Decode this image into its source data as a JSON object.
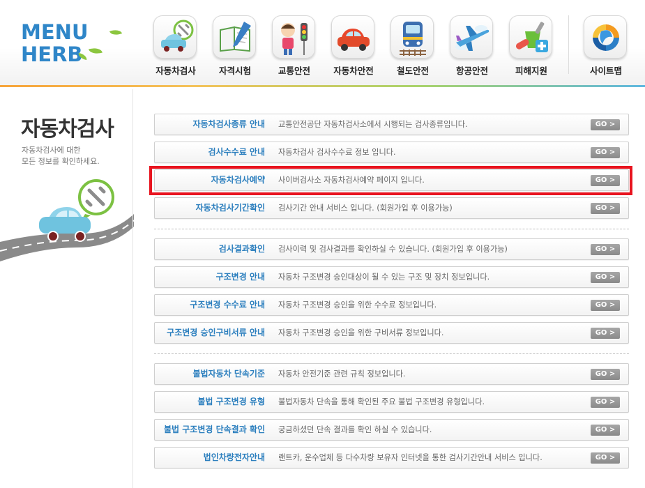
{
  "logo": {
    "line1": "MENU",
    "line2": "HERB"
  },
  "nav": [
    {
      "label": "자동차검사",
      "icon": "car-inspection-icon"
    },
    {
      "label": "자격시험",
      "icon": "notebook-pencil-icon"
    },
    {
      "label": "교통안전",
      "icon": "child-traffic-light-icon"
    },
    {
      "label": "자동차안전",
      "icon": "red-car-icon"
    },
    {
      "label": "철도안전",
      "icon": "train-icon"
    },
    {
      "label": "항공안전",
      "icon": "airplane-icon"
    },
    {
      "label": "피해지원",
      "icon": "medicine-cross-icon"
    },
    {
      "label": "사이트맵",
      "icon": "sitemap-logo-icon"
    }
  ],
  "left": {
    "title": "자동차검사",
    "desc_line1": "자동차검사에 대한",
    "desc_line2": "모든 정보를 확인하세요."
  },
  "go_label": "GO >",
  "rows": [
    {
      "title": "자동차검사종류 안내",
      "desc": "교통안전공단 자동차검사소에서 시행되는 검사종류입니다."
    },
    {
      "title": "검사수수료 안내",
      "desc": "자동차검사 검사수수료 정보 입니다."
    },
    {
      "title": "자동차검사예약",
      "desc": "사이버검사소 자동차검사예약 페이지 입니다."
    },
    {
      "title": "자동차검사기간확인",
      "desc": "검사기간 안내 서비스 입니다. (회원가입 후 이용가능)"
    },
    {
      "title": "검사결과확인",
      "desc": "검사이력 및 검사결과를 확인하실 수 있습니다. (회원가입 후 이용가능)"
    },
    {
      "title": "구조변경 안내",
      "desc": "자동차 구조변경 승인대상이 될 수 있는 구조 및 장치 정보입니다."
    },
    {
      "title": "구조변경 수수료 안내",
      "desc": "자동차 구조변경 승인을 위한 수수료 정보입니다."
    },
    {
      "title": "구조변경 승인구비서류 안내",
      "desc": "자동차 구조변경 승인을 위한 구비서류 정보입니다."
    },
    {
      "title": "불법자동차 단속기준",
      "desc": "자동차 안전기준 관련 규칙 정보입니다."
    },
    {
      "title": "불법 구조변경 유형",
      "desc": "불법자동차 단속을 통해 확인된 주요 불법 구조변경 유형입니다."
    },
    {
      "title": "불법 구조변경 단속결과 확인",
      "desc": "궁금하셨던 단속 결과를 확인 하실 수 있습니다."
    },
    {
      "title": "법인차량전자안내",
      "desc": "랜트카, 운수업체 등 다수차량 보유자 인터넷을 통한 검사기간안내 서비스 입니다."
    }
  ],
  "colors": {
    "highlight": "#e8141f",
    "title_blue": "#2c7fbe",
    "logo_blue": "#2f86c8",
    "leaf_green": "#8cc63f"
  }
}
